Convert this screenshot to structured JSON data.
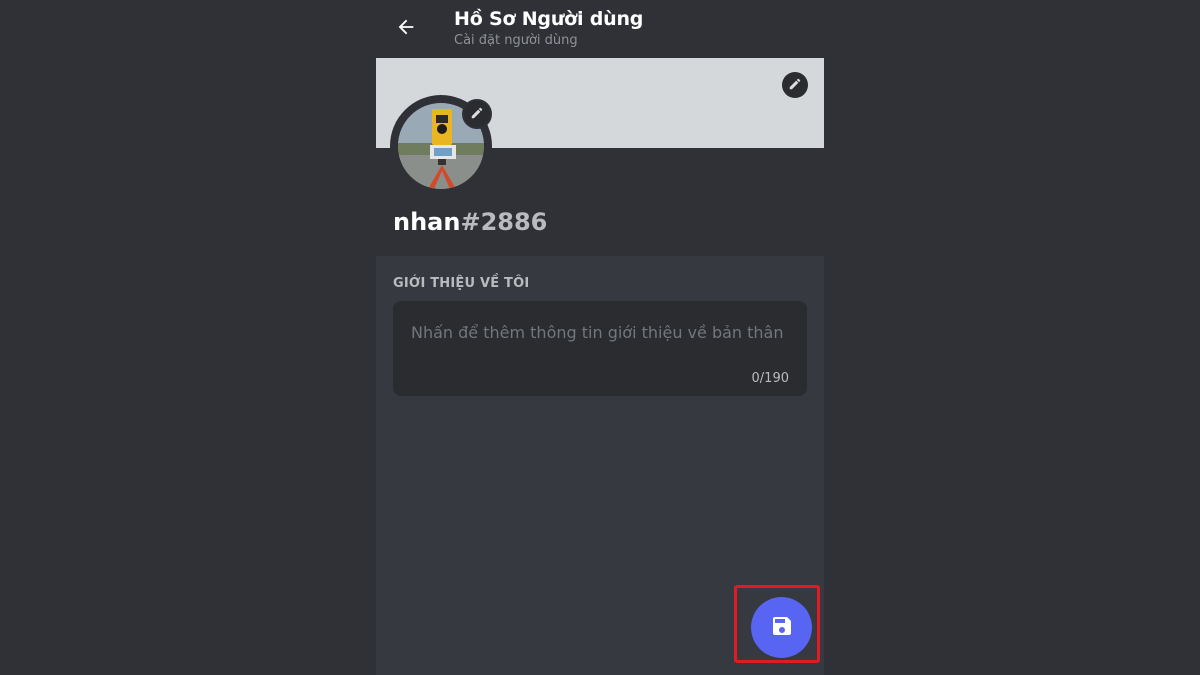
{
  "header": {
    "title": "Hồ Sơ Người dùng",
    "subtitle": "Cài đặt người dùng"
  },
  "profile": {
    "username": "nhan",
    "discriminator": "#2886"
  },
  "about": {
    "section_label": "GIỚI THIỆU VỀ TÔI",
    "placeholder": "Nhấn để thêm thông tin giới thiệu về bản thân",
    "counter": "0/190"
  },
  "icons": {
    "back": "arrow-left-icon",
    "banner_edit": "pencil-icon",
    "avatar_edit": "pencil-icon",
    "save": "floppy-disk-icon"
  },
  "colors": {
    "accent": "#5865f2",
    "highlight": "#e01b24",
    "banner": "#d5d8da"
  }
}
